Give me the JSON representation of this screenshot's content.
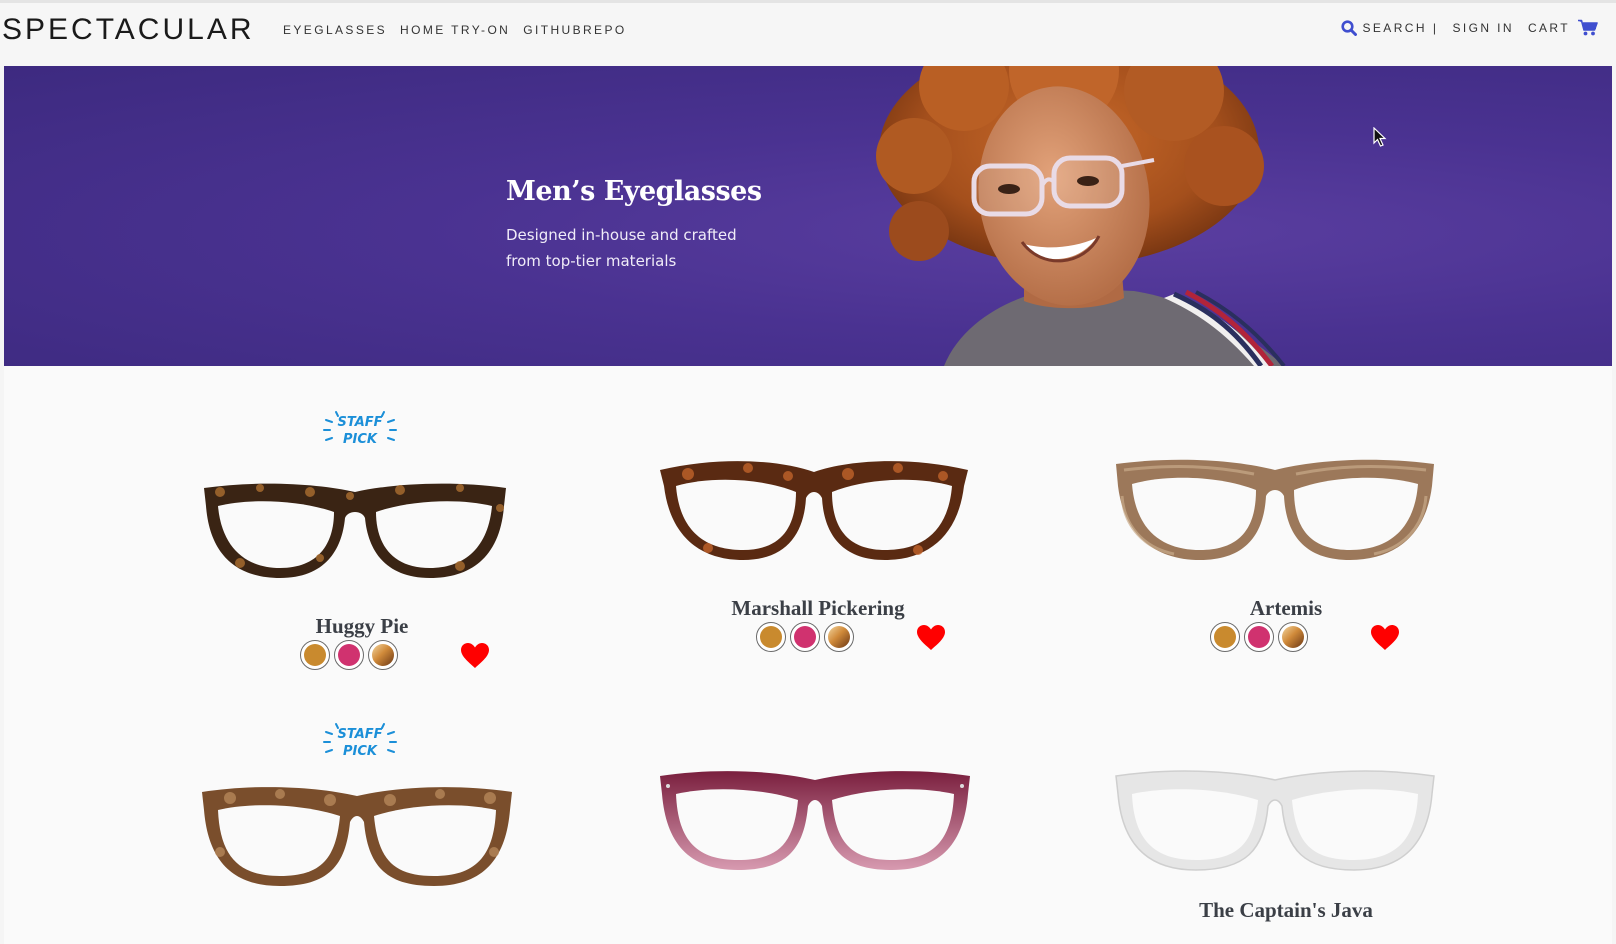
{
  "brand": {
    "logo": "SPECTACULAR"
  },
  "nav": {
    "items": [
      "EYEGLASSES",
      "HOME TRY-ON",
      "GITHUBREPO"
    ]
  },
  "utility": {
    "search": "SEARCH",
    "separator": "|",
    "signin": "SIGN IN",
    "cart": "CART"
  },
  "hero": {
    "title": "Men’s Eyeglasses",
    "subtitle": "Designed in-house and crafted from top-tier materials"
  },
  "badge": {
    "line1": "STAFF",
    "line2": "PICK"
  },
  "colors": {
    "accent": "#3f4ecf",
    "heart": "#ff0000",
    "swatch_honey": "#c98a2e",
    "swatch_berry": "#d0326f",
    "swatch_tortoise": "#8a4a1c"
  },
  "products": [
    {
      "name": "Huggy Pie",
      "staff_pick": true,
      "frame": "tortoise-dark",
      "swatches": [
        "honey",
        "berry",
        "tortoise"
      ]
    },
    {
      "name": "Marshall Pickering",
      "staff_pick": false,
      "frame": "tortoise-red",
      "swatches": [
        "honey",
        "berry",
        "tortoise"
      ]
    },
    {
      "name": "Artemis",
      "staff_pick": false,
      "frame": "wood-light",
      "swatches": [
        "honey",
        "berry",
        "tortoise"
      ]
    },
    {
      "name": "",
      "staff_pick": true,
      "frame": "tortoise-brown",
      "swatches": []
    },
    {
      "name": "",
      "staff_pick": false,
      "frame": "rose-fade",
      "swatches": []
    },
    {
      "name": "The Captain's Java",
      "staff_pick": false,
      "frame": "crystal-clear",
      "swatches": []
    }
  ]
}
